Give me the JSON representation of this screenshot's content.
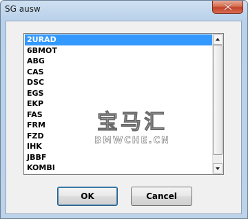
{
  "window": {
    "title": "SG ausw"
  },
  "listbox": {
    "items": [
      {
        "label": "2URAD",
        "selected": true
      },
      {
        "label": "6BMOT",
        "selected": false
      },
      {
        "label": "ABG",
        "selected": false
      },
      {
        "label": "CAS",
        "selected": false
      },
      {
        "label": "DSC",
        "selected": false
      },
      {
        "label": "EGS",
        "selected": false
      },
      {
        "label": "EKP",
        "selected": false
      },
      {
        "label": "FAS",
        "selected": false
      },
      {
        "label": "FRM",
        "selected": false
      },
      {
        "label": "FZD",
        "selected": false
      },
      {
        "label": "IHK",
        "selected": false
      },
      {
        "label": "JBBF",
        "selected": false
      },
      {
        "label": "KOMBI",
        "selected": false
      }
    ]
  },
  "buttons": {
    "ok_label": "OK",
    "cancel_label": "Cancel"
  },
  "watermark": {
    "chinese": "宝马汇",
    "latin": "BMWCHE.CN"
  },
  "colors": {
    "selection": "#3399ff",
    "close_button": "#c2432a",
    "title_bar": "#b9d1ea"
  },
  "icons": {
    "close": "close-x-icon",
    "scroll_up": "up-arrow-icon",
    "scroll_down": "down-arrow-icon"
  }
}
